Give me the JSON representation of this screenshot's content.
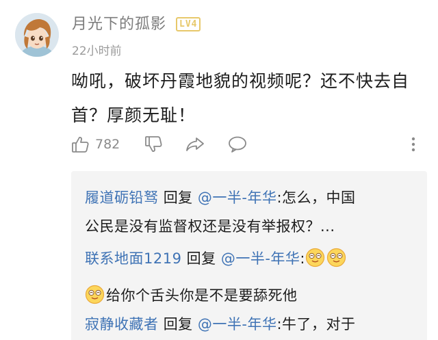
{
  "comment": {
    "username": "月光下的孤影",
    "level": "LV4",
    "time": "22小时前",
    "text": "呦吼，破坏丹霞地貌的视频呢？还不快去自首？厚颜无耻！",
    "likes": "782"
  },
  "icons": {
    "like": "thumbs-up-icon",
    "dislike": "thumbs-down-icon",
    "share": "share-arrow-icon",
    "reply": "speech-bubble-icon",
    "more": "vertical-dots-icon",
    "emoji": "smiling-face-emoji"
  },
  "replies": [
    {
      "user": "履道砺铅驽",
      "reply_word": "回复",
      "mention": "@一半-年华",
      "text_line1": ":怎么，中国",
      "text_line2": "公民是没有监督权还是没有举报权？..."
    },
    {
      "user": "联系地面1219",
      "reply_word": "回复",
      "mention": "@一半-年华",
      "text_line1": ":",
      "text_line2": "给你个舌头你是不是要舔死他"
    },
    {
      "user": "寂静收藏者",
      "reply_word": "回复",
      "mention": "@一半-年华",
      "text_line1": ":牛了，对于"
    }
  ],
  "colors": {
    "link_blue": "#3f73b5",
    "badge_gold": "#e7c86a",
    "meta_gray": "#9b9b9b",
    "reply_bg": "#f4f4f4"
  }
}
